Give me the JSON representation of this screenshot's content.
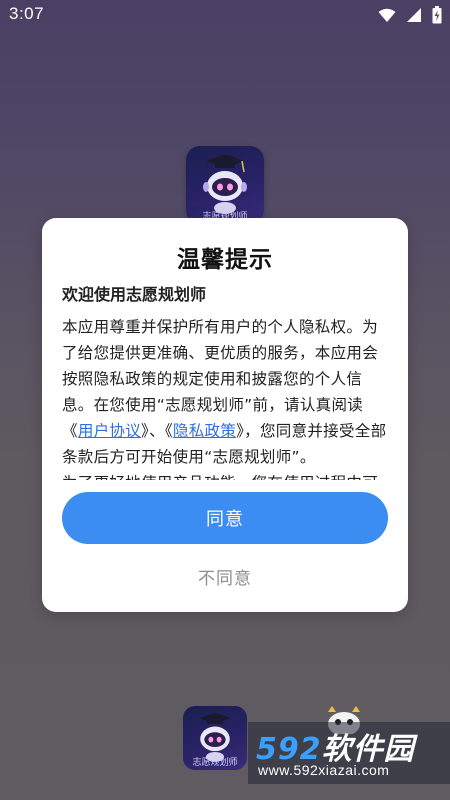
{
  "status_bar": {
    "time": "3:07",
    "icons": [
      "wifi-icon",
      "cell-signal-icon",
      "battery-charging-icon"
    ]
  },
  "background_app": {
    "icon_caption": "志愿规划师"
  },
  "dialog": {
    "title": "温馨提示",
    "heading": "欢迎使用志愿规划师",
    "paragraph_1_part_1": "本应用尊重并保护所有用户的个人隐私权。为了给您提供更准确、更优质的服务，本应用会按照隐私政策的规定使用和披露您的个人信息。在您使用“志愿规划师”前，请认真阅读《",
    "link_user_agreement": "用户协议",
    "paragraph_1_part_2": "》、《",
    "link_privacy_policy": "隐私政策",
    "paragraph_1_part_3": "》，您同意并接受全部条款后方可开始使用“志愿规划师”。",
    "paragraph_2": "为了更好地使用产品功能，您在使用过程中可",
    "agree_label": "同意",
    "disagree_label": "不同意"
  },
  "watermark": {
    "logo_number": "592",
    "logo_text": "软件园",
    "url": "www.592xiazai.com"
  },
  "colors": {
    "accent": "#3b8df2",
    "link": "#2d6ee0",
    "secondary_text": "#8d8d8d"
  }
}
